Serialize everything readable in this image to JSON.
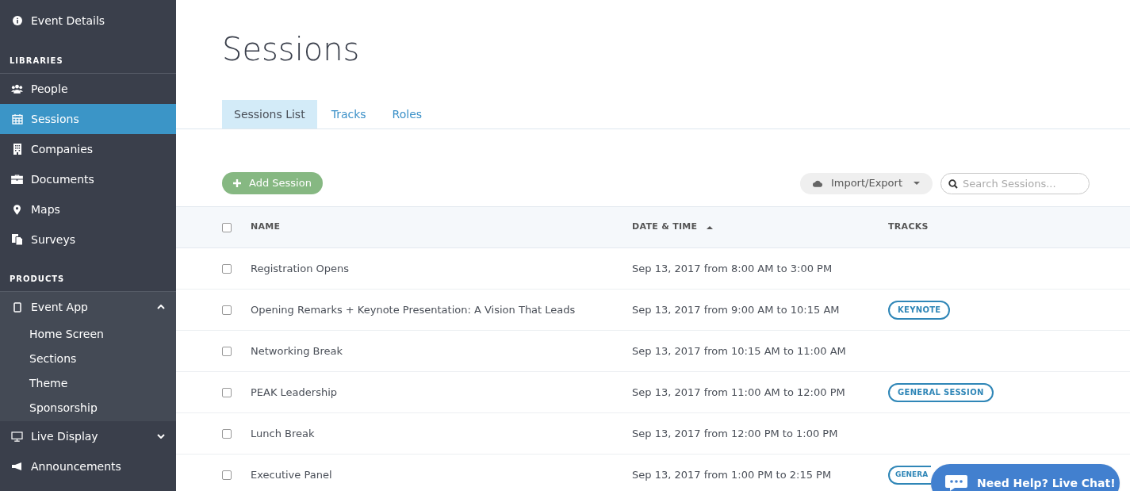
{
  "sidebar": {
    "top_item": {
      "label": "Event Details"
    },
    "sections": [
      {
        "heading": "LIBRARIES",
        "items": [
          {
            "label": "People",
            "selected": false
          },
          {
            "label": "Sessions",
            "selected": true
          },
          {
            "label": "Companies",
            "selected": false
          },
          {
            "label": "Documents",
            "selected": false
          },
          {
            "label": "Maps",
            "selected": false
          },
          {
            "label": "Surveys",
            "selected": false
          }
        ]
      },
      {
        "heading": "PRODUCTS",
        "items": [
          {
            "label": "Event App",
            "expanded": true,
            "children": [
              {
                "label": "Home Screen"
              },
              {
                "label": "Sections"
              },
              {
                "label": "Theme"
              },
              {
                "label": "Sponsorship"
              }
            ]
          },
          {
            "label": "Live Display",
            "expanded": false
          },
          {
            "label": "Announcements"
          }
        ]
      }
    ]
  },
  "page": {
    "title": "Sessions",
    "tabs": [
      {
        "label": "Sessions List",
        "selected": true
      },
      {
        "label": "Tracks",
        "selected": false
      },
      {
        "label": "Roles",
        "selected": false
      }
    ],
    "add_button": "Add Session",
    "import_export": "Import/Export",
    "search": {
      "placeholder": "Search Sessions..."
    }
  },
  "table": {
    "all_checked": false,
    "columns": [
      {
        "label": "NAME",
        "sorted": false
      },
      {
        "label": "DATE & TIME",
        "sorted": true
      },
      {
        "label": "TRACKS",
        "sorted": false
      }
    ],
    "rows": [
      {
        "checked": false,
        "name": "Registration Opens",
        "date": "Sep 13, 2017 from 8:00 AM to 3:00 PM",
        "tracks": []
      },
      {
        "checked": false,
        "name": "Opening Remarks + Keynote Presentation: A Vision That Leads",
        "date": "Sep 13, 2017 from 9:00 AM to 10:15 AM",
        "tracks": [
          "KEYNOTE"
        ]
      },
      {
        "checked": false,
        "name": "Networking Break",
        "date": "Sep 13, 2017 from 10:15 AM to 11:00 AM",
        "tracks": []
      },
      {
        "checked": false,
        "name": "PEAK Leadership",
        "date": "Sep 13, 2017 from 11:00 AM to 12:00 PM",
        "tracks": [
          "GENERAL SESSION"
        ]
      },
      {
        "checked": false,
        "name": "Lunch Break",
        "date": "Sep 13, 2017 from 12:00 PM to 1:00 PM",
        "tracks": []
      },
      {
        "checked": false,
        "name": "Executive Panel",
        "date": "Sep 13, 2017 from 1:00 PM to 2:15 PM",
        "tracks": [
          "GENERA"
        ]
      }
    ]
  },
  "chat_button": "Need Help? Live Chat!"
}
